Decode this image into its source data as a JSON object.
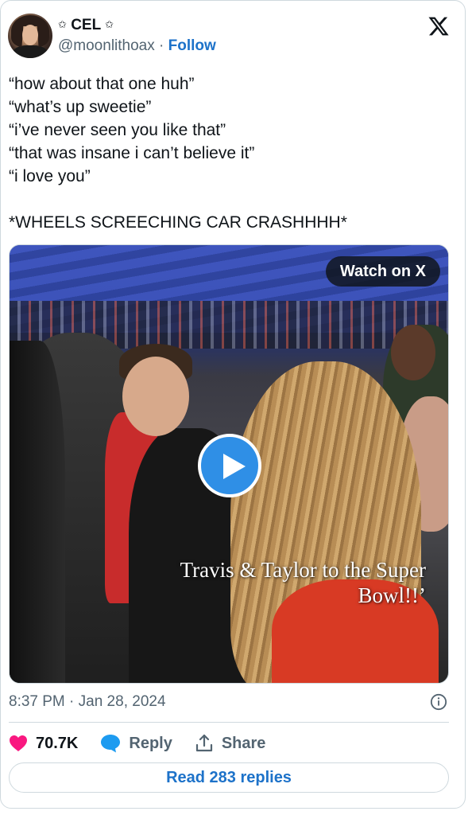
{
  "author": {
    "display_name": "CEL",
    "star_left": "✩",
    "star_right": "✩",
    "handle": "@moonlithoax",
    "separator": "·",
    "follow_label": "Follow"
  },
  "platform": {
    "logo_icon": "x-logo-icon"
  },
  "tweet": {
    "lines": [
      "“how about that one huh”",
      "“what’s up sweetie”",
      "“i’ve never seen you like that”",
      "“that was insane i can’t believe it”",
      "“i love you”"
    ],
    "closing_line": "*WHEELS SCREECHING CAR CRASHHHH*"
  },
  "media": {
    "watch_label": "Watch on X",
    "caption_line1": "Travis & Taylor to the Super",
    "caption_line2": "Bowl!!’",
    "play_icon": "play-icon"
  },
  "meta": {
    "timestamp": "8:37 PM · Jan 28, 2024"
  },
  "actions": {
    "like_count": "70.7K",
    "reply_label": "Reply",
    "share_label": "Share",
    "read_replies_label": "Read 283 replies"
  },
  "colors": {
    "like_heart": "#f91880",
    "reply_bubble": "#1d9bf0",
    "link_blue": "#1d72c9",
    "play_button": "#2f8fe6"
  }
}
